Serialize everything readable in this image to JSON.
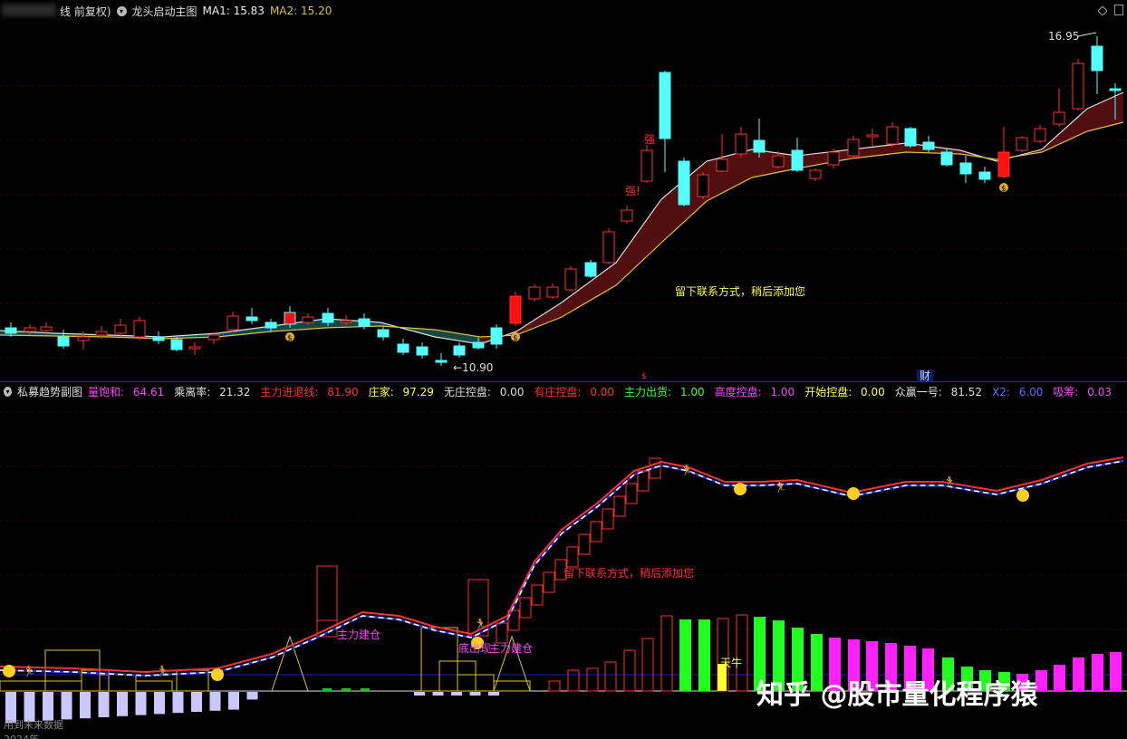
{
  "main_panel": {
    "title_prefix": "线 前复权)",
    "indicator_name": "龙头启动主图",
    "ma1_label": "MA1: 15.83",
    "ma2_label": "MA2: 15.20",
    "high_label": "16.95",
    "low_label": "10.90",
    "note": "留下联系方式，稍后添加您",
    "strong1": "强",
    "strong2": "强!",
    "money_marker": "$",
    "cai_marker": "财"
  },
  "sub_panel": {
    "indicator_name": "私募趋势副图",
    "values": [
      {
        "label": "量饱和",
        "value": "64.61",
        "color": "#ff44ff"
      },
      {
        "label": "乘离率",
        "value": "21.32",
        "color": "#dddddd"
      },
      {
        "label": "主力进退线",
        "value": "81.90",
        "color": "#ff3030"
      },
      {
        "label": "庄家",
        "value": "97.29",
        "color": "#ffff40"
      },
      {
        "label": "无庄控盘",
        "value": "0.00",
        "color": "#dddddd"
      },
      {
        "label": "有庄控盘",
        "value": "0.00",
        "color": "#ff3030"
      },
      {
        "label": "主力出货",
        "value": "1.00",
        "color": "#40ff40"
      },
      {
        "label": "高度控盘",
        "value": "1.00",
        "color": "#ff44ff"
      },
      {
        "label": "开始控盘",
        "value": "0.00",
        "color": "#ffff40"
      },
      {
        "label": "众赢一号",
        "value": "81.52",
        "color": "#dddddd"
      },
      {
        "label": "X2",
        "value": "6.00",
        "color": "#6666ff"
      },
      {
        "label": "吸筹",
        "value": "0.03",
        "color": "#ff44ff"
      }
    ],
    "note": "留下联系方式，稍后添加您",
    "label_build1": "主力建仓",
    "label_build2": "主力建仓",
    "label_bottom": "底出现",
    "label_tianniu": "天牛",
    "footer_text": "用到未来数据",
    "axis_year": "2024年"
  },
  "watermark": "知乎 @股市量化程序猿",
  "colors": {
    "up": "#ff3030",
    "down": "#54ffff",
    "ma1": "#dddddd",
    "ma2": "#e0c030",
    "ribbon_up": "#5a1010",
    "ribbon_down": "#1a5a55",
    "green_bar": "#20ff20",
    "magenta_bar": "#ff20ff",
    "lavender_bar": "#c8c8ff"
  }
}
